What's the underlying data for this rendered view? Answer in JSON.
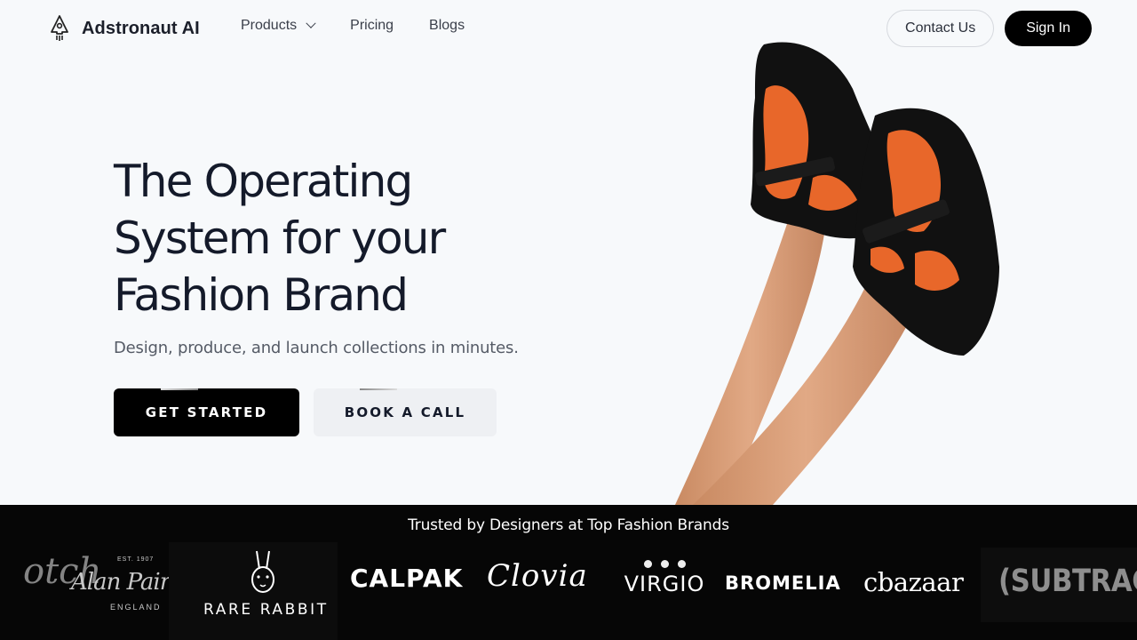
{
  "header": {
    "brand_name": "Adstronaut AI",
    "brand_icon": "rocket-icon",
    "nav": [
      {
        "label": "Products",
        "has_dropdown": true
      },
      {
        "label": "Pricing"
      },
      {
        "label": "Blogs"
      }
    ],
    "contact_label": "Contact Us",
    "signin_label": "Sign In"
  },
  "hero": {
    "title_lines": [
      "The Operating",
      "System for your",
      "Fashion Brand"
    ],
    "subtitle": "Design, produce, and launch collections in minutes.",
    "primary_cta": "GET STARTED",
    "secondary_cta": "BOOK A CALL"
  },
  "brands": {
    "heading": "Trusted by Designers at Top Fashion Brands",
    "logos": [
      {
        "text": "otch"
      },
      {
        "est": "EST. 1907",
        "name": "Alan Paine",
        "sub": "ENGLAND"
      },
      {
        "text": "RARE RABBIT"
      },
      {
        "text": "CALPAK"
      },
      {
        "text": "Clovia"
      },
      {
        "text": "VIRGIO"
      },
      {
        "text": "BROMELIA"
      },
      {
        "text": "cbazaar"
      },
      {
        "text": "(SUBTRACT"
      }
    ]
  },
  "colors": {
    "background": "#f7f9fb",
    "primary": "#000000",
    "strip": "#060606",
    "shoe_accent": "#e8672a"
  }
}
